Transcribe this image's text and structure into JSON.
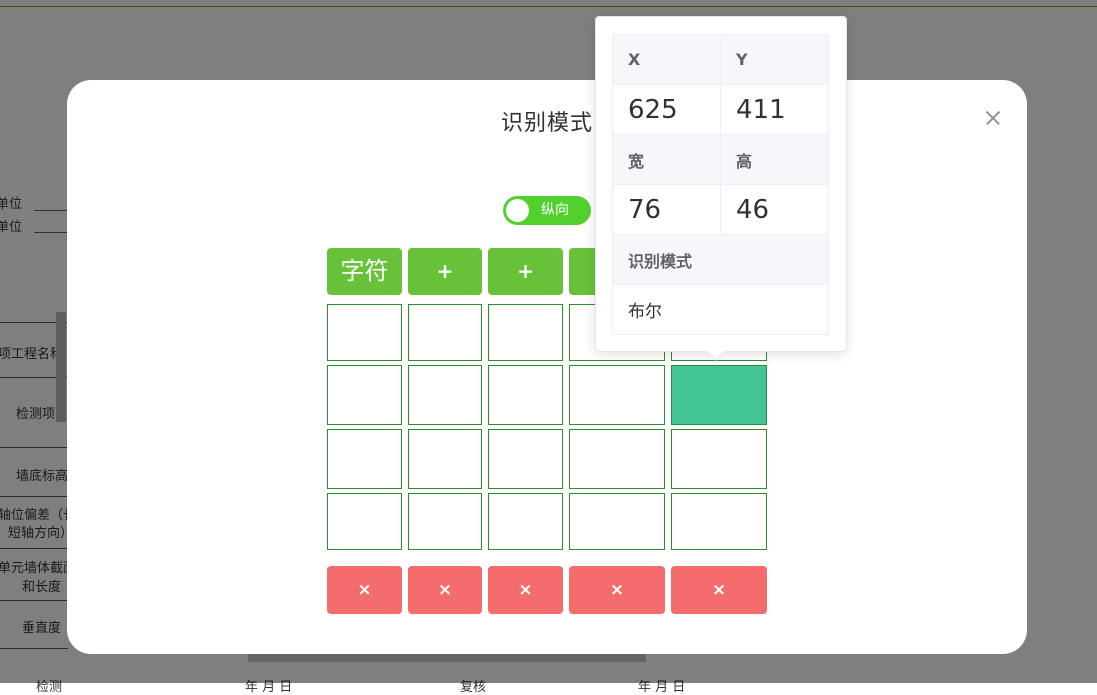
{
  "background": {
    "label_unit_1": "单位",
    "label_unit_2": "单位",
    "project_name": "项工程名称",
    "check_item": "检测项目",
    "wall_bottom": "墙底标高",
    "offset_1": "轴位偏差（长",
    "offset_2": "短轴方向）",
    "section_1": "单元墙体截面",
    "section_2": "和长度",
    "vertical": "垂直度",
    "bottom_1": "检测",
    "bottom_2": "年     月     日",
    "bottom_3": "复核",
    "bottom_4": "年     月     日"
  },
  "dialog": {
    "title": "识别模式",
    "toggle_label": "纵向",
    "columns": [
      {
        "header": "字符",
        "kind": "text"
      },
      {
        "header": "+",
        "kind": "plus"
      },
      {
        "header": "+",
        "kind": "plus"
      },
      {
        "header": "+",
        "kind": "plus"
      },
      {
        "header": "+",
        "kind": "plus"
      }
    ],
    "grid": {
      "rows": 4,
      "cols": 5,
      "selected": {
        "row": 1,
        "col": 4
      }
    },
    "delete_label": "×"
  },
  "popover": {
    "x_label": "X",
    "y_label": "Y",
    "x_value": "625",
    "y_value": "411",
    "w_label": "宽",
    "h_label": "高",
    "w_value": "76",
    "h_value": "46",
    "mode_label": "识别模式",
    "mode_value": "布尔"
  },
  "colors": {
    "header_green": "#67c23a",
    "toggle_green": "#52d12c",
    "cell_border": "#2e8b2e",
    "selected_cell": "#42c593",
    "delete_red": "#f56c6c"
  }
}
